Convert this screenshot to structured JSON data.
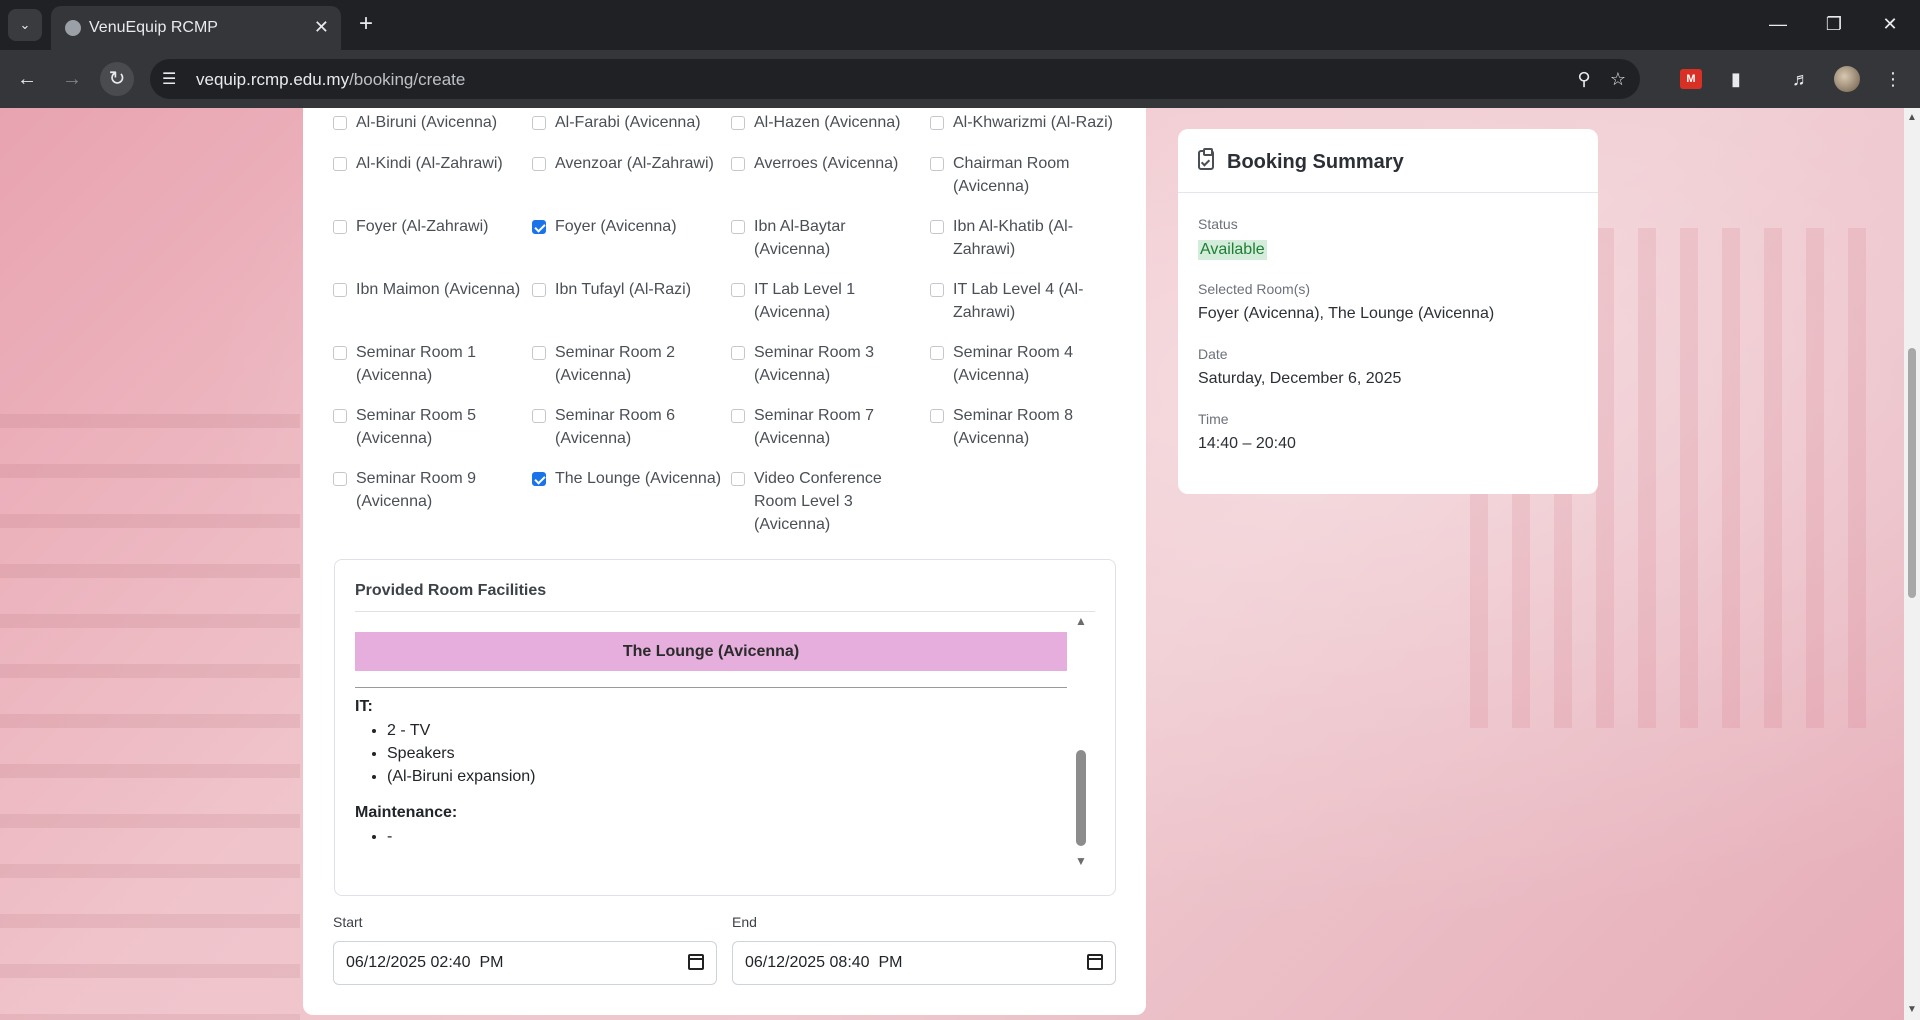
{
  "browser": {
    "tab_title": "VenuEquip RCMP",
    "url_host": "vequip.rcmp.edu.my",
    "url_path": "/booking/create",
    "icons": [
      "tab-list-icon",
      "close-icon",
      "plus-icon",
      "minimize-icon",
      "restore-icon",
      "window-close-icon",
      "back-icon",
      "forward-icon",
      "reload-icon",
      "site-info-icon",
      "zoom-icon",
      "star-icon",
      "extension-icon",
      "media-icon",
      "profile-avatar"
    ]
  },
  "rooms": [
    {
      "label": "Al-Biruni (Avicenna)",
      "checked": false
    },
    {
      "label": "Al-Farabi (Avicenna)",
      "checked": false
    },
    {
      "label": "Al-Hazen (Avicenna)",
      "checked": false
    },
    {
      "label": "Al-Khwarizmi (Al-Razi)",
      "checked": false
    },
    {
      "label": "Al-Kindi (Al-Zahrawi)",
      "checked": false
    },
    {
      "label": "Avenzoar (Al-Zahrawi)",
      "checked": false
    },
    {
      "label": "Averroes (Avicenna)",
      "checked": false
    },
    {
      "label": "Chairman Room (Avicenna)",
      "checked": false
    },
    {
      "label": "Foyer (Al-Zahrawi)",
      "checked": false
    },
    {
      "label": "Foyer (Avicenna)",
      "checked": true
    },
    {
      "label": "Ibn Al-Baytar (Avicenna)",
      "checked": false
    },
    {
      "label": "Ibn Al-Khatib (Al-Zahrawi)",
      "checked": false
    },
    {
      "label": "Ibn Maimon (Avicenna)",
      "checked": false
    },
    {
      "label": "Ibn Tufayl (Al-Razi)",
      "checked": false
    },
    {
      "label": "IT Lab Level 1 (Avicenna)",
      "checked": false
    },
    {
      "label": "IT Lab Level 4 (Al-Zahrawi)",
      "checked": false
    },
    {
      "label": "Seminar Room 1 (Avicenna)",
      "checked": false
    },
    {
      "label": "Seminar Room 2 (Avicenna)",
      "checked": false
    },
    {
      "label": "Seminar Room 3 (Avicenna)",
      "checked": false
    },
    {
      "label": "Seminar Room 4 (Avicenna)",
      "checked": false
    },
    {
      "label": "Seminar Room 5 (Avicenna)",
      "checked": false
    },
    {
      "label": "Seminar Room 6 (Avicenna)",
      "checked": false
    },
    {
      "label": "Seminar Room 7 (Avicenna)",
      "checked": false
    },
    {
      "label": "Seminar Room 8 (Avicenna)",
      "checked": false
    },
    {
      "label": "Seminar Room 9 (Avicenna)",
      "checked": false
    },
    {
      "label": "The Lounge (Avicenna)",
      "checked": true
    },
    {
      "label": "Video Conference Room Level 3 (Avicenna)",
      "checked": false
    }
  ],
  "facilities": {
    "title": "Provided Room Facilities",
    "room_name": "The Lounge (Avicenna)",
    "room_color": "#e5aedd",
    "categories": [
      {
        "label": "IT:",
        "items": [
          "2 - TV",
          "Speakers",
          "(Al-Biruni expansion)"
        ]
      },
      {
        "label": "Maintenance:",
        "items": [
          "-"
        ]
      }
    ]
  },
  "datetime": {
    "start_label": "Start",
    "start_value": "06/12/2025 02:40  PM",
    "end_label": "End",
    "end_value": "06/12/2025 08:40  PM"
  },
  "summary": {
    "title": "Booking Summary",
    "status_label": "Status",
    "status_value": "Available",
    "status_color": "#1e7e34",
    "rooms_label": "Selected Room(s)",
    "rooms_value": "Foyer (Avicenna), The Lounge (Avicenna)",
    "date_label": "Date",
    "date_value": "Saturday, December 6, 2025",
    "time_label": "Time",
    "time_value": "14:40 – 20:40"
  }
}
